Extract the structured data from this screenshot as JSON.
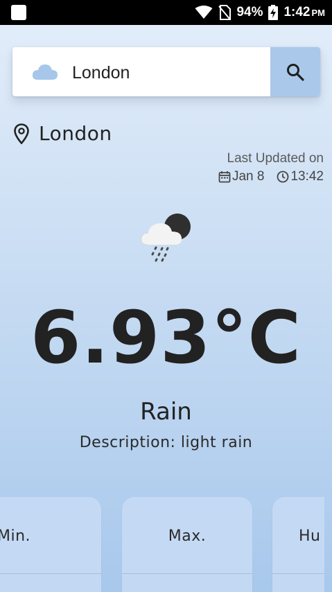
{
  "status_bar": {
    "battery": "94%",
    "time": "1:42",
    "ampm": "PM"
  },
  "search": {
    "value": "London",
    "icon": "cloud-icon",
    "button_icon": "search-icon"
  },
  "location": {
    "name": "London",
    "icon": "location-pin-icon"
  },
  "last_updated": {
    "label": "Last Updated on",
    "date": "Jan 8",
    "time": "13:42"
  },
  "weather": {
    "icon": "rain-cloud-moon-icon",
    "temperature": "6.93°C",
    "condition": "Rain",
    "description": "Description: light rain"
  },
  "stats": [
    {
      "label": "Min."
    },
    {
      "label": "Max."
    },
    {
      "label": "Hu"
    }
  ],
  "colors": {
    "search_button": "#aac8ea",
    "card": "#c8dcf4"
  }
}
